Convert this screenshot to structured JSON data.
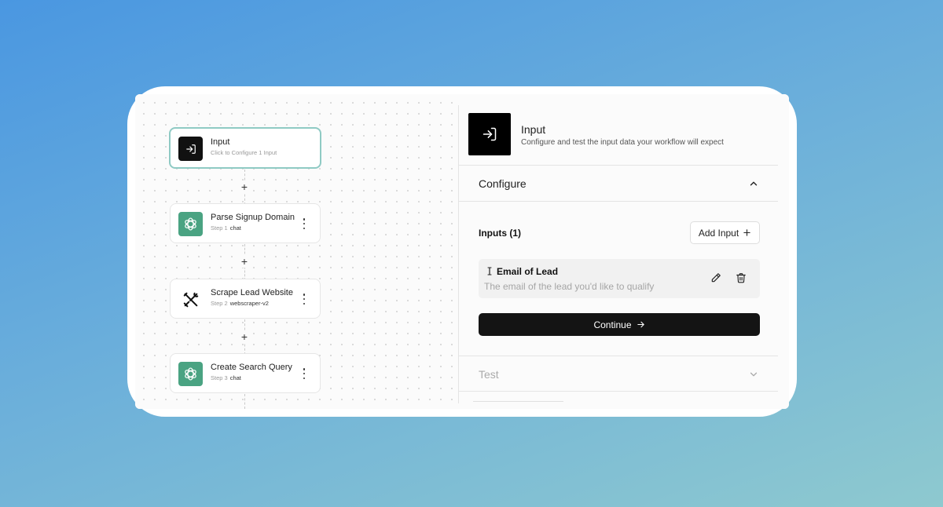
{
  "workflow": {
    "nodes": [
      {
        "title": "Input",
        "subtitle": "Click to Configure 1 Input",
        "icon": "sign-in-icon"
      },
      {
        "title": "Parse Signup Domain",
        "step": "Step 1",
        "tag": "chat",
        "icon": "openai-icon"
      },
      {
        "title": "Scrape Lead Website",
        "step": "Step 2",
        "tag": "webscraper-v2",
        "icon": "tools-icon"
      },
      {
        "title": "Create Search Query",
        "step": "Step 3",
        "tag": "chat",
        "icon": "openai-icon"
      }
    ],
    "add_step_symbol": "+"
  },
  "panel": {
    "title": "Input",
    "description": "Configure and test the input data your workflow will expect",
    "configure": {
      "title": "Configure",
      "inputs_label": "Inputs (1)",
      "add_input_label": "Add Input",
      "inputs": [
        {
          "name": "Email of Lead",
          "placeholder": "The email of the lead you'd like to qualify"
        }
      ],
      "continue_label": "Continue"
    },
    "test": {
      "title": "Test"
    }
  },
  "colors": {
    "accent_green": "#4aa382",
    "selected_border": "#8fcac4",
    "button_dark": "#141414"
  }
}
